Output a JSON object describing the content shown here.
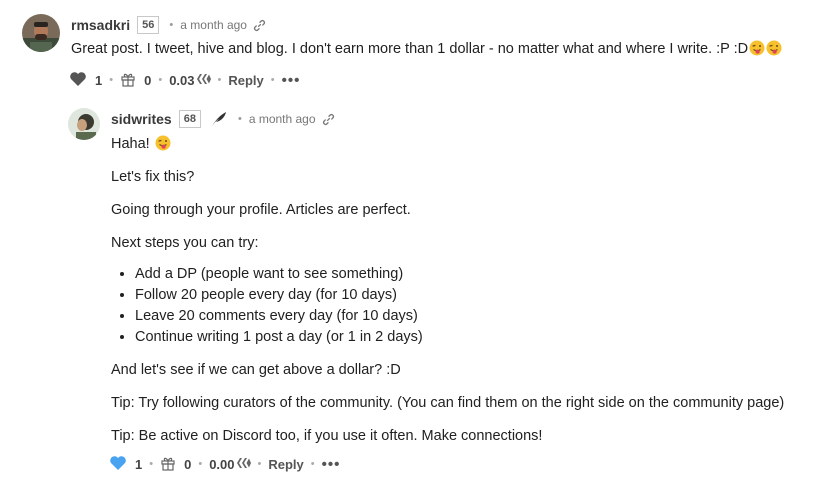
{
  "comments": [
    {
      "author": "rmsadkri",
      "reputation": "56",
      "time": "a month ago",
      "text": "Great post. I tweet, hive and blog. I don't earn more than 1 dollar - no matter what and where I write. :P :D",
      "emojis": [
        "tongue-wink-emoji",
        "tongue-wink-emoji"
      ],
      "votes": "1",
      "gifts": "0",
      "payout": "0.03",
      "reply_label": "Reply",
      "more_label": "•••",
      "upvote_color": "#555555"
    },
    {
      "author": "sidwrites",
      "reputation": "68",
      "time": "a month ago",
      "greeting": "Haha!",
      "paragraphs": [
        "Let's fix this?",
        "Going through your profile. Articles are perfect.",
        "Next steps you can try:"
      ],
      "steps": [
        "Add a DP (people want to see something)",
        "Follow 20 people every day (for 10 days)",
        "Leave 20 comments every day (for 10 days)",
        "Continue writing 1 post a day (or 1 in 2 days)"
      ],
      "closing": [
        "And let's see if we can get above a dollar? :D",
        "Tip: Try following curators of the community. (You can find them on the right side on the community page)",
        "Tip: Be active on Discord too, if you use it often. Make connections!"
      ],
      "votes": "1",
      "gifts": "0",
      "payout": "0.00",
      "reply_label": "Reply",
      "more_label": "•••",
      "upvote_color": "#4aa3f0"
    }
  ],
  "separator": "•"
}
